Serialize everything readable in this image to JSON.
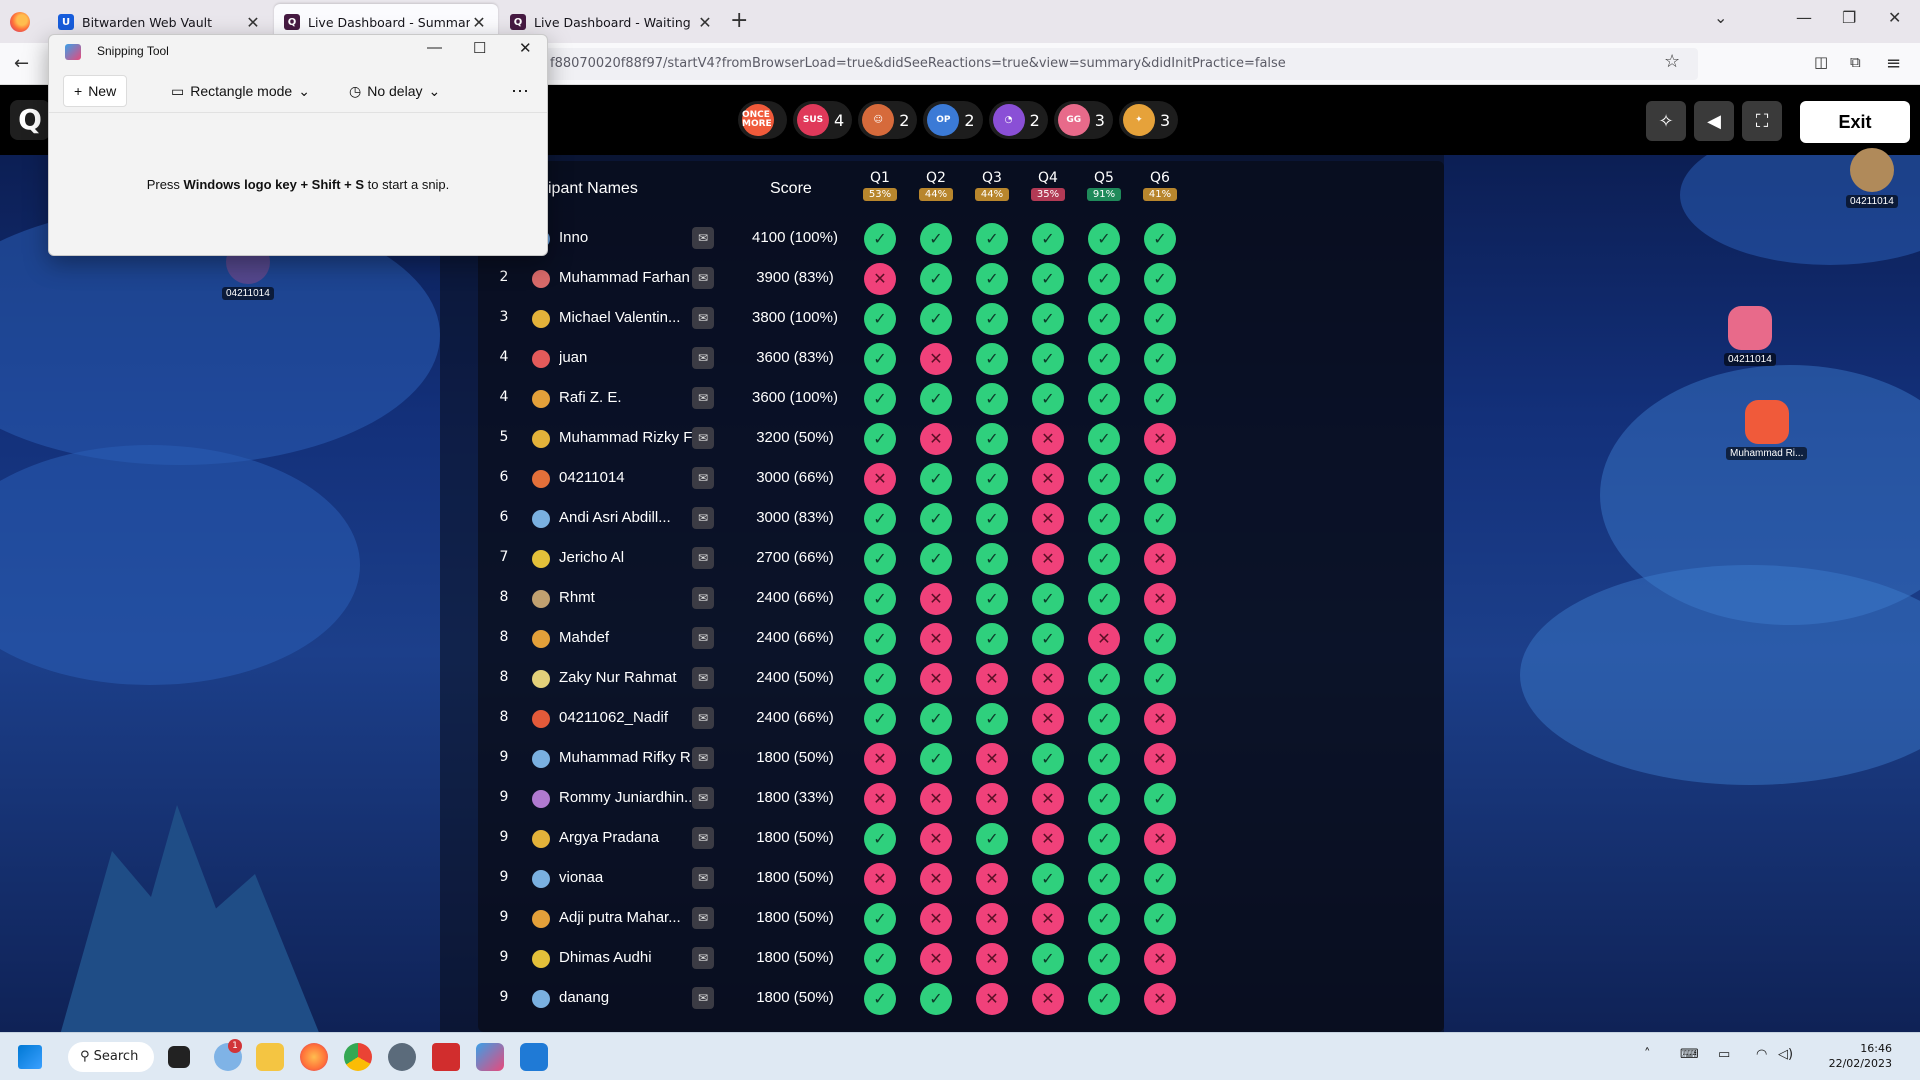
{
  "browser": {
    "tabs": [
      {
        "label": "Bitwarden Web Vault",
        "favicon_color": "#175ddc",
        "active": false
      },
      {
        "label": "Live Dashboard - Summary",
        "favicon_color": "#461a42",
        "active": true
      },
      {
        "label": "Live Dashboard - Waiting",
        "favicon_color": "#461a42",
        "active": false
      }
    ],
    "url": "f88070020f88f97/startV4?fromBrowserLoad=true&didSeeReactions=true&view=summary&didInitPractice=false"
  },
  "snipping_tool": {
    "title": "Snipping Tool",
    "new_label": "New",
    "mode_label": "Rectangle mode",
    "delay_label": "No delay",
    "hint_prefix": "Press ",
    "hint_keys": "Windows logo key + Shift + S",
    "hint_suffix": " to start a snip."
  },
  "quiz_bar": {
    "reactions": [
      {
        "icon": "once-more-emoji",
        "label": "ONCE MORE",
        "count": "",
        "color": "#f05a3a"
      },
      {
        "icon": "sus-emoji",
        "label": "SUS",
        "count": "4",
        "color": "#e0395a"
      },
      {
        "icon": "laughing-emoji",
        "label": "",
        "count": "2",
        "color": "#d66a3b"
      },
      {
        "icon": "op-emoji",
        "label": "OP",
        "count": "2",
        "color": "#3b7ad6"
      },
      {
        "icon": "ghost-emoji",
        "label": "",
        "count": "2",
        "color": "#8a4fd6"
      },
      {
        "icon": "gg-emoji",
        "label": "GG",
        "count": "3",
        "color": "#e86a8a"
      },
      {
        "icon": "party-emoji",
        "label": "",
        "count": "3",
        "color": "#e6a23a"
      }
    ],
    "exit_label": "Exit"
  },
  "table": {
    "name_header": "cipant Names",
    "score_header": "Score",
    "questions": [
      {
        "label": "Q1",
        "pct": "53%",
        "color": "#b8862d"
      },
      {
        "label": "Q2",
        "pct": "44%",
        "color": "#b8862d"
      },
      {
        "label": "Q3",
        "pct": "44%",
        "color": "#b8862d"
      },
      {
        "label": "Q4",
        "pct": "35%",
        "color": "#b23a55"
      },
      {
        "label": "Q5",
        "pct": "91%",
        "color": "#1f8a5a"
      },
      {
        "label": "Q6",
        "pct": "41%",
        "color": "#b8862d"
      }
    ],
    "rows": [
      {
        "rank": "",
        "name": "Inno",
        "score": "4100 (100%)",
        "answers": [
          1,
          1,
          1,
          1,
          1,
          1
        ],
        "avatar": "#6a9fd8"
      },
      {
        "rank": "2",
        "name": "Muhammad Farhan",
        "score": "3900 (83%)",
        "answers": [
          0,
          1,
          1,
          1,
          1,
          1
        ],
        "avatar": "#d86a6a"
      },
      {
        "rank": "3",
        "name": "Michael Valentin...",
        "score": "3800 (100%)",
        "answers": [
          1,
          1,
          1,
          1,
          1,
          1
        ],
        "avatar": "#e3b23a"
      },
      {
        "rank": "4",
        "name": "juan",
        "score": "3600 (83%)",
        "answers": [
          1,
          0,
          1,
          1,
          1,
          1
        ],
        "avatar": "#e35a5a"
      },
      {
        "rank": "4",
        "name": "Rafi Z. E.",
        "score": "3600 (100%)",
        "answers": [
          1,
          1,
          1,
          1,
          1,
          1
        ],
        "avatar": "#e3a03a"
      },
      {
        "rank": "5",
        "name": "Muhammad Rizky F...",
        "score": "3200 (50%)",
        "answers": [
          1,
          0,
          1,
          0,
          1,
          0
        ],
        "avatar": "#e3b23a"
      },
      {
        "rank": "6",
        "name": "04211014",
        "score": "3000 (66%)",
        "answers": [
          0,
          1,
          1,
          0,
          1,
          1
        ],
        "avatar": "#e3703a"
      },
      {
        "rank": "6",
        "name": "Andi Asri Abdill...",
        "score": "3000 (83%)",
        "answers": [
          1,
          1,
          1,
          0,
          1,
          1
        ],
        "avatar": "#7ab0e0"
      },
      {
        "rank": "7",
        "name": "Jericho Al",
        "score": "2700 (66%)",
        "answers": [
          1,
          1,
          1,
          0,
          1,
          0
        ],
        "avatar": "#e3c03a"
      },
      {
        "rank": "8",
        "name": "Rhmt",
        "score": "2400 (66%)",
        "answers": [
          1,
          0,
          1,
          1,
          1,
          0
        ],
        "avatar": "#c0a070"
      },
      {
        "rank": "8",
        "name": "Mahdef",
        "score": "2400 (66%)",
        "answers": [
          1,
          0,
          1,
          1,
          0,
          1
        ],
        "avatar": "#e3a03a"
      },
      {
        "rank": "8",
        "name": "Zaky Nur Rahmat",
        "score": "2400 (50%)",
        "answers": [
          1,
          0,
          0,
          0,
          1,
          1
        ],
        "avatar": "#e3d07a"
      },
      {
        "rank": "8",
        "name": "04211062_Nadif",
        "score": "2400 (66%)",
        "answers": [
          1,
          1,
          1,
          0,
          1,
          0
        ],
        "avatar": "#e35a3a"
      },
      {
        "rank": "9",
        "name": "Muhammad Rifky R...",
        "score": "1800 (50%)",
        "answers": [
          0,
          1,
          0,
          1,
          1,
          0
        ],
        "avatar": "#7ab0e0"
      },
      {
        "rank": "9",
        "name": "Rommy Juniardhin...",
        "score": "1800 (33%)",
        "answers": [
          0,
          0,
          0,
          0,
          1,
          1
        ],
        "avatar": "#b07ad0"
      },
      {
        "rank": "9",
        "name": "Argya Pradana",
        "score": "1800 (50%)",
        "answers": [
          1,
          0,
          1,
          0,
          1,
          0
        ],
        "avatar": "#e3b23a"
      },
      {
        "rank": "9",
        "name": "vionaa",
        "score": "1800 (50%)",
        "answers": [
          0,
          0,
          0,
          1,
          1,
          1
        ],
        "avatar": "#7ab0e0"
      },
      {
        "rank": "9",
        "name": "Adji putra Mahar...",
        "score": "1800 (50%)",
        "answers": [
          1,
          0,
          0,
          0,
          1,
          1
        ],
        "avatar": "#e3a03a"
      },
      {
        "rank": "9",
        "name": "Dhimas Audhi",
        "score": "1800 (50%)",
        "answers": [
          1,
          0,
          0,
          1,
          1,
          0
        ],
        "avatar": "#e3c03a"
      },
      {
        "rank": "9",
        "name": "danang",
        "score": "1800 (50%)",
        "answers": [
          1,
          1,
          0,
          0,
          1,
          0
        ],
        "avatar": "#7ab0e0"
      }
    ]
  },
  "floaters": [
    {
      "label": "04211014",
      "color": "#7a4a8a"
    },
    {
      "label": "04211014",
      "color": "#b08a5a"
    },
    {
      "label": "04211014",
      "color": "#e86a8a"
    },
    {
      "label": "Muhammad Ri...",
      "color": "#f05a3a"
    }
  ],
  "taskbar": {
    "search_label": "Search",
    "notification_count": "1",
    "time": "16:46",
    "date": "22/02/2023"
  }
}
